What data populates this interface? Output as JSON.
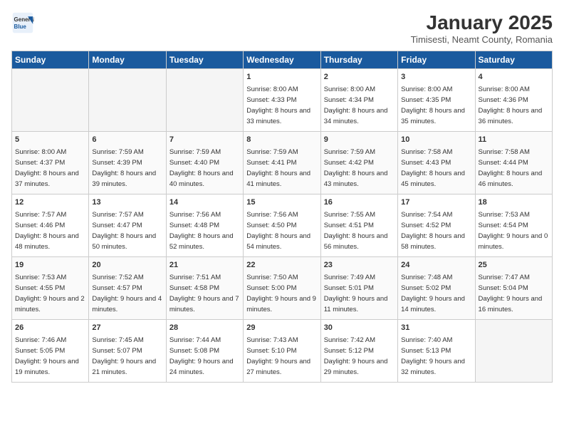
{
  "logo": {
    "general": "General",
    "blue": "Blue"
  },
  "header": {
    "month": "January 2025",
    "location": "Timisesti, Neamt County, Romania"
  },
  "weekdays": [
    "Sunday",
    "Monday",
    "Tuesday",
    "Wednesday",
    "Thursday",
    "Friday",
    "Saturday"
  ],
  "weeks": [
    [
      {
        "day": "",
        "empty": true
      },
      {
        "day": "",
        "empty": true
      },
      {
        "day": "",
        "empty": true
      },
      {
        "day": "1",
        "sunrise": "Sunrise: 8:00 AM",
        "sunset": "Sunset: 4:33 PM",
        "daylight": "Daylight: 8 hours and 33 minutes."
      },
      {
        "day": "2",
        "sunrise": "Sunrise: 8:00 AM",
        "sunset": "Sunset: 4:34 PM",
        "daylight": "Daylight: 8 hours and 34 minutes."
      },
      {
        "day": "3",
        "sunrise": "Sunrise: 8:00 AM",
        "sunset": "Sunset: 4:35 PM",
        "daylight": "Daylight: 8 hours and 35 minutes."
      },
      {
        "day": "4",
        "sunrise": "Sunrise: 8:00 AM",
        "sunset": "Sunset: 4:36 PM",
        "daylight": "Daylight: 8 hours and 36 minutes."
      }
    ],
    [
      {
        "day": "5",
        "sunrise": "Sunrise: 8:00 AM",
        "sunset": "Sunset: 4:37 PM",
        "daylight": "Daylight: 8 hours and 37 minutes."
      },
      {
        "day": "6",
        "sunrise": "Sunrise: 7:59 AM",
        "sunset": "Sunset: 4:39 PM",
        "daylight": "Daylight: 8 hours and 39 minutes."
      },
      {
        "day": "7",
        "sunrise": "Sunrise: 7:59 AM",
        "sunset": "Sunset: 4:40 PM",
        "daylight": "Daylight: 8 hours and 40 minutes."
      },
      {
        "day": "8",
        "sunrise": "Sunrise: 7:59 AM",
        "sunset": "Sunset: 4:41 PM",
        "daylight": "Daylight: 8 hours and 41 minutes."
      },
      {
        "day": "9",
        "sunrise": "Sunrise: 7:59 AM",
        "sunset": "Sunset: 4:42 PM",
        "daylight": "Daylight: 8 hours and 43 minutes."
      },
      {
        "day": "10",
        "sunrise": "Sunrise: 7:58 AM",
        "sunset": "Sunset: 4:43 PM",
        "daylight": "Daylight: 8 hours and 45 minutes."
      },
      {
        "day": "11",
        "sunrise": "Sunrise: 7:58 AM",
        "sunset": "Sunset: 4:44 PM",
        "daylight": "Daylight: 8 hours and 46 minutes."
      }
    ],
    [
      {
        "day": "12",
        "sunrise": "Sunrise: 7:57 AM",
        "sunset": "Sunset: 4:46 PM",
        "daylight": "Daylight: 8 hours and 48 minutes."
      },
      {
        "day": "13",
        "sunrise": "Sunrise: 7:57 AM",
        "sunset": "Sunset: 4:47 PM",
        "daylight": "Daylight: 8 hours and 50 minutes."
      },
      {
        "day": "14",
        "sunrise": "Sunrise: 7:56 AM",
        "sunset": "Sunset: 4:48 PM",
        "daylight": "Daylight: 8 hours and 52 minutes."
      },
      {
        "day": "15",
        "sunrise": "Sunrise: 7:56 AM",
        "sunset": "Sunset: 4:50 PM",
        "daylight": "Daylight: 8 hours and 54 minutes."
      },
      {
        "day": "16",
        "sunrise": "Sunrise: 7:55 AM",
        "sunset": "Sunset: 4:51 PM",
        "daylight": "Daylight: 8 hours and 56 minutes."
      },
      {
        "day": "17",
        "sunrise": "Sunrise: 7:54 AM",
        "sunset": "Sunset: 4:52 PM",
        "daylight": "Daylight: 8 hours and 58 minutes."
      },
      {
        "day": "18",
        "sunrise": "Sunrise: 7:53 AM",
        "sunset": "Sunset: 4:54 PM",
        "daylight": "Daylight: 9 hours and 0 minutes."
      }
    ],
    [
      {
        "day": "19",
        "sunrise": "Sunrise: 7:53 AM",
        "sunset": "Sunset: 4:55 PM",
        "daylight": "Daylight: 9 hours and 2 minutes."
      },
      {
        "day": "20",
        "sunrise": "Sunrise: 7:52 AM",
        "sunset": "Sunset: 4:57 PM",
        "daylight": "Daylight: 9 hours and 4 minutes."
      },
      {
        "day": "21",
        "sunrise": "Sunrise: 7:51 AM",
        "sunset": "Sunset: 4:58 PM",
        "daylight": "Daylight: 9 hours and 7 minutes."
      },
      {
        "day": "22",
        "sunrise": "Sunrise: 7:50 AM",
        "sunset": "Sunset: 5:00 PM",
        "daylight": "Daylight: 9 hours and 9 minutes."
      },
      {
        "day": "23",
        "sunrise": "Sunrise: 7:49 AM",
        "sunset": "Sunset: 5:01 PM",
        "daylight": "Daylight: 9 hours and 11 minutes."
      },
      {
        "day": "24",
        "sunrise": "Sunrise: 7:48 AM",
        "sunset": "Sunset: 5:02 PM",
        "daylight": "Daylight: 9 hours and 14 minutes."
      },
      {
        "day": "25",
        "sunrise": "Sunrise: 7:47 AM",
        "sunset": "Sunset: 5:04 PM",
        "daylight": "Daylight: 9 hours and 16 minutes."
      }
    ],
    [
      {
        "day": "26",
        "sunrise": "Sunrise: 7:46 AM",
        "sunset": "Sunset: 5:05 PM",
        "daylight": "Daylight: 9 hours and 19 minutes."
      },
      {
        "day": "27",
        "sunrise": "Sunrise: 7:45 AM",
        "sunset": "Sunset: 5:07 PM",
        "daylight": "Daylight: 9 hours and 21 minutes."
      },
      {
        "day": "28",
        "sunrise": "Sunrise: 7:44 AM",
        "sunset": "Sunset: 5:08 PM",
        "daylight": "Daylight: 9 hours and 24 minutes."
      },
      {
        "day": "29",
        "sunrise": "Sunrise: 7:43 AM",
        "sunset": "Sunset: 5:10 PM",
        "daylight": "Daylight: 9 hours and 27 minutes."
      },
      {
        "day": "30",
        "sunrise": "Sunrise: 7:42 AM",
        "sunset": "Sunset: 5:12 PM",
        "daylight": "Daylight: 9 hours and 29 minutes."
      },
      {
        "day": "31",
        "sunrise": "Sunrise: 7:40 AM",
        "sunset": "Sunset: 5:13 PM",
        "daylight": "Daylight: 9 hours and 32 minutes."
      },
      {
        "day": "",
        "empty": true
      }
    ]
  ]
}
